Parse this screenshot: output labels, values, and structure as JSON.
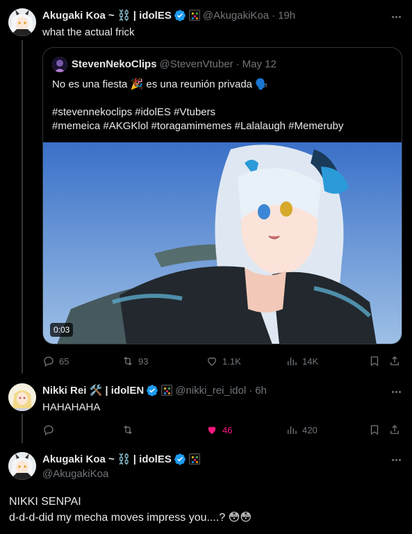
{
  "post1": {
    "display_name": "Akugaki Koa ~ ⛓️ | idolES",
    "handle": "@AkugakiKoa",
    "time": "19h",
    "text": "what the actual frick",
    "quote": {
      "display_name": "StevenNekoClips",
      "handle": "@StevenVtuber",
      "date": "May 12",
      "line1": "No es una fiesta 🎉 es una reunión privada 🗣️",
      "line2": "#stevennekoclips #idolES #Vtubers",
      "line3": "#memeica #AKGKlol #toragamimemes #Lalalaugh #Memeruby",
      "video_duration": "0:03"
    },
    "stats": {
      "replies": "65",
      "reposts": "93",
      "likes": "1.1K",
      "views": "14K"
    }
  },
  "post2": {
    "display_name": "Nikki Rei 🛠️ | idolEN",
    "handle": "@nikki_rei_idol",
    "time": "6h",
    "text": "HAHAHAHA",
    "stats": {
      "replies": "",
      "reposts": "",
      "likes": "46",
      "views": "420"
    }
  },
  "post3": {
    "display_name": "Akugaki Koa ~ ⛓️ | idolES",
    "handle": "@AkugakiKoa",
    "line1": "NIKKI SENPAI",
    "line2": "d-d-d-did my mecha moves impress you....? 😳😳"
  },
  "colors": {
    "background": "#000000",
    "text": "#e7e9ea",
    "muted": "#71767b",
    "verified": "#1d9bf0",
    "like": "#f91880",
    "border": "#2f3336"
  }
}
